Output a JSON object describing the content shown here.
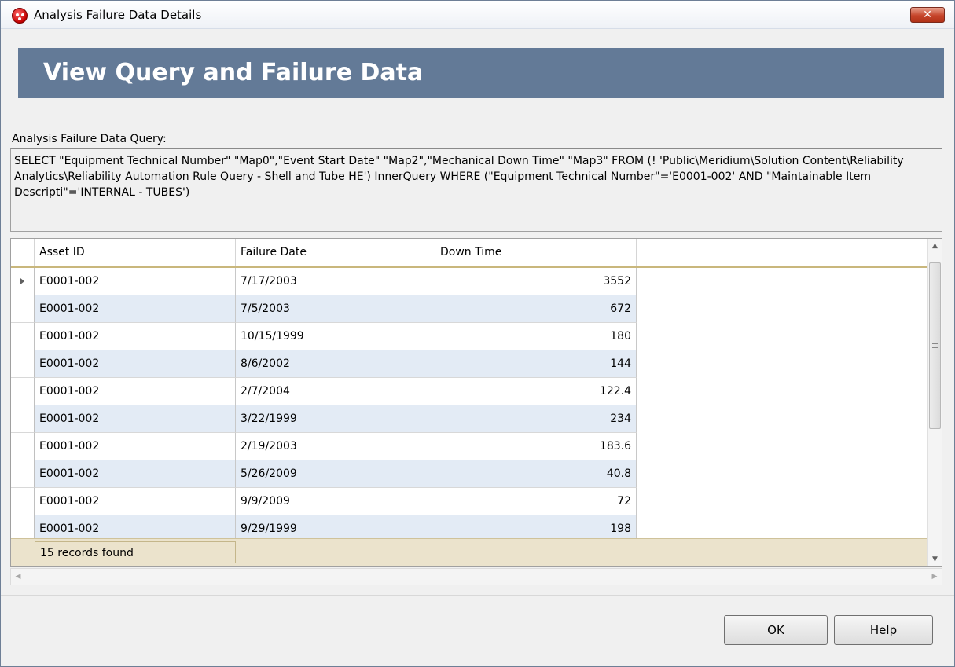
{
  "window": {
    "title": "Analysis Failure Data Details",
    "close_label": "✕"
  },
  "banner": {
    "title": "View Query and Failure Data"
  },
  "query": {
    "label": "Analysis Failure Data Query:",
    "text": "SELECT \"Equipment Technical Number\" \"Map0\",\"Event Start Date\" \"Map2\",\"Mechanical Down Time\" \"Map3\" FROM (! 'Public\\Meridium\\Solution Content\\Reliability Analytics\\Reliability Automation Rule Query - Shell and Tube HE') InnerQuery WHERE (\"Equipment Technical Number\"='E0001-002' AND \"Maintainable Item Descripti\"='INTERNAL - TUBES')"
  },
  "grid": {
    "columns": [
      "Asset ID",
      "Failure Date",
      "Down Time"
    ],
    "rows": [
      {
        "asset": "E0001-002",
        "date": "7/17/2003",
        "down": "3552"
      },
      {
        "asset": "E0001-002",
        "date": "7/5/2003",
        "down": "672"
      },
      {
        "asset": "E0001-002",
        "date": "10/15/1999",
        "down": "180"
      },
      {
        "asset": "E0001-002",
        "date": "8/6/2002",
        "down": "144"
      },
      {
        "asset": "E0001-002",
        "date": "2/7/2004",
        "down": "122.4"
      },
      {
        "asset": "E0001-002",
        "date": "3/22/1999",
        "down": "234"
      },
      {
        "asset": "E0001-002",
        "date": "2/19/2003",
        "down": "183.6"
      },
      {
        "asset": "E0001-002",
        "date": "5/26/2009",
        "down": "40.8"
      },
      {
        "asset": "E0001-002",
        "date": "9/9/2009",
        "down": "72"
      },
      {
        "asset": "E0001-002",
        "date": "9/29/1999",
        "down": "198"
      }
    ],
    "footer": "15 records found"
  },
  "buttons": {
    "ok": "OK",
    "help": "Help"
  }
}
